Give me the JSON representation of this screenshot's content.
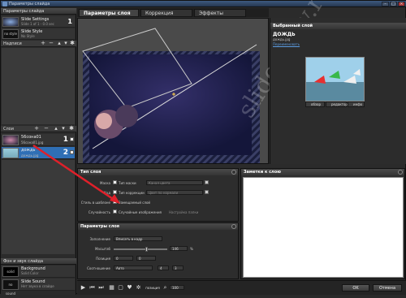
{
  "window": {
    "title": "Параметры слайда"
  },
  "left": {
    "slide_params_title": "Параметры слайда",
    "slides": [
      {
        "title": "Slide Settings",
        "sub": "Slide 1 of 1 - 0.0 sec",
        "num": "1"
      },
      {
        "title": "Slide Style",
        "sub": "No Style",
        "thumb": "no style"
      }
    ],
    "captions_label": "Надписи",
    "layers_label": "Слои",
    "layers": [
      {
        "title": "56сона01",
        "sub": "56сона01.jpg",
        "num": "1"
      },
      {
        "title": "дождь",
        "sub": "дождь.jpg",
        "num": "2"
      }
    ],
    "sound_title": "Фон и звук слайда",
    "sound_items": [
      {
        "title": "Background",
        "sub": "Solid Color",
        "thumb": "solid"
      },
      {
        "title": "Slide Sound",
        "sub": "Нет звука в слайде",
        "thumb": "no sound"
      }
    ]
  },
  "tabs": [
    "Параметры слоя",
    "Коррекция",
    "Эффекты"
  ],
  "right": {
    "header": "Выбранный слой",
    "name": "ДОЖДЬ",
    "file": "дождь.jpg",
    "link": "Переименовать",
    "buttons": [
      "обзор",
      "редактор",
      "инфо"
    ]
  },
  "layer_type": {
    "title": "Тип слоя",
    "rows": [
      {
        "label": "Маска",
        "check": "Тип маски",
        "field": "Канал цвета"
      },
      {
        "label": "Ход",
        "check": "Тип коррекции",
        "field": "Цвет по нормали"
      },
      {
        "label": "Стиль в шаблоне",
        "check": "Замещаемый слой"
      },
      {
        "label": "Случайность",
        "check": "Случайные изображения",
        "extra": "Настройка папки"
      }
    ]
  },
  "layer_params": {
    "title": "Параметры слоя",
    "fill_label": "Заполнение",
    "fill_value": "Вписать в кадр",
    "scale_label": "Масштаб",
    "scale_value": "146",
    "scale_unit": "%",
    "scale_fraction": 0.62,
    "pos_label": "Позиция",
    "pos_x": "0",
    "pos_y": "0",
    "ratio_label": "Соотношение",
    "ratio_value": "Авто",
    "ratio_a": "4",
    "ratio_b": "3"
  },
  "notes": {
    "title": "Заметки к слою"
  },
  "bottombar": {
    "zoom": "100",
    "zoom_caption": "позиция",
    "ok": "OK",
    "cancel": "Отмена"
  },
  "colors": {
    "selection": "#2f6fb5",
    "arrow": "#e0202a"
  }
}
